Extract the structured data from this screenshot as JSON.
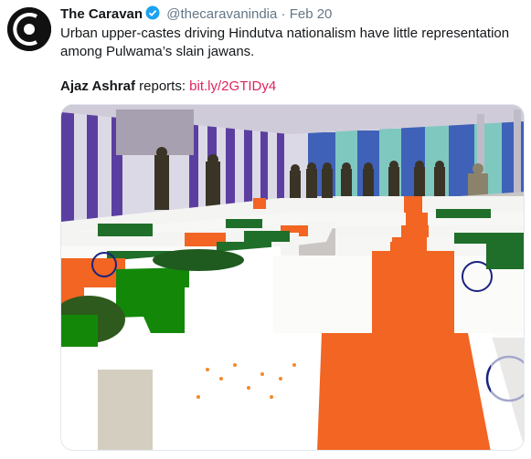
{
  "tweet": {
    "author_name": "The Caravan",
    "handle": "@thecaravanindia",
    "separator": "·",
    "date": "Feb 20",
    "text": "Urban upper-castes driving Hindutva nationalism have little representation among Pulwama’s slain jawans.",
    "reporter": "Ajaz Ashraf",
    "reports_label": "reports:",
    "link": "bit.ly/2GTIDy4"
  },
  "icons": {
    "avatar": "caravan-logo",
    "verified": "verified-badge-icon"
  },
  "colors": {
    "link": "#e0245e",
    "verified": "#1da1f2",
    "muted": "#657786",
    "saffron": "#f26522",
    "flag_green": "#138808"
  }
}
